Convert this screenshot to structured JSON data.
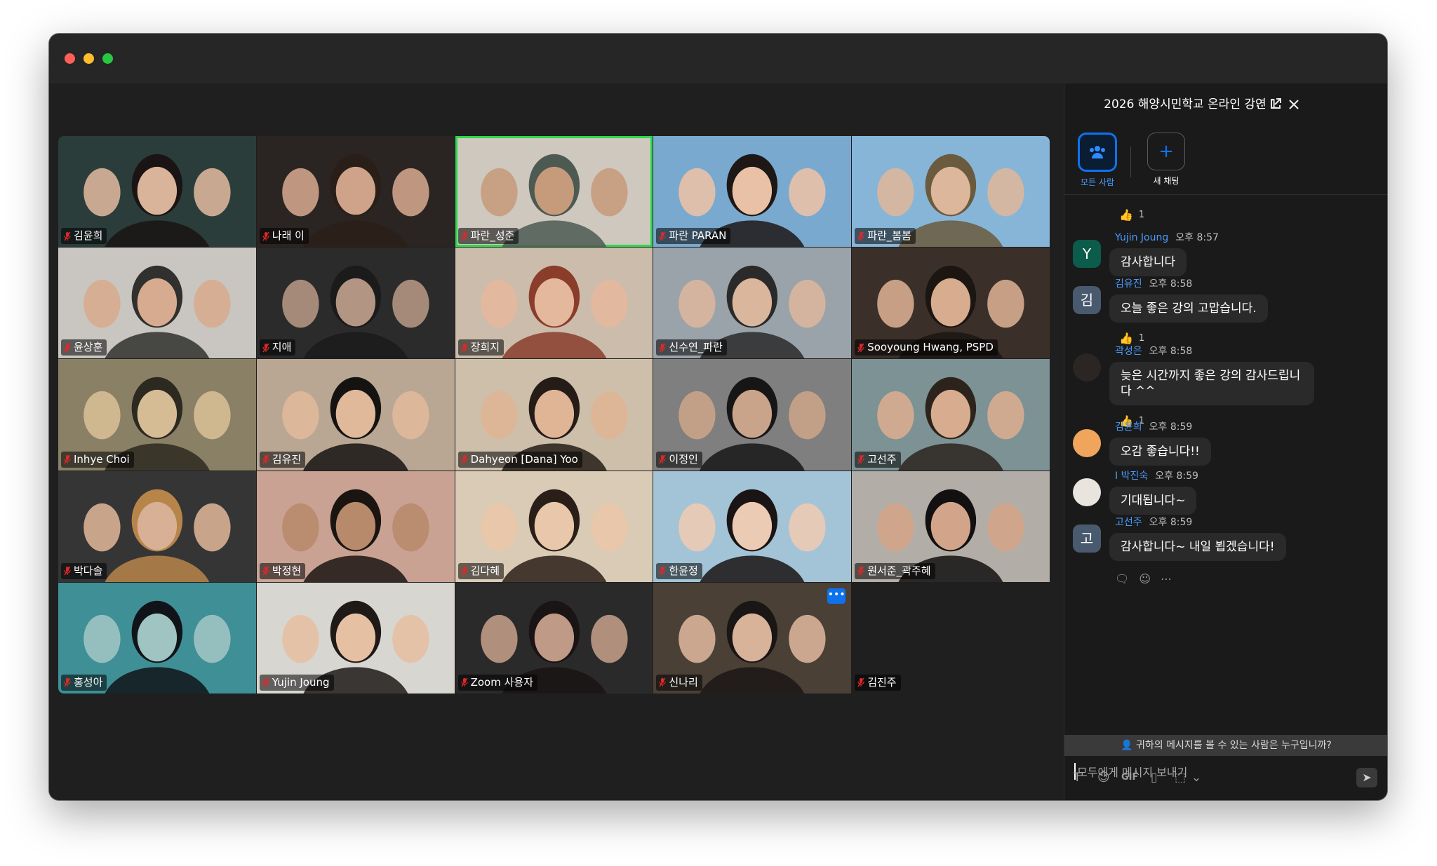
{
  "meeting": {
    "tiles": [
      {
        "name": "김윤희",
        "bg": "#2b3d3a",
        "skin": "#d9b49a",
        "hair": "#1a1414"
      },
      {
        "name": "나래 이",
        "bg": "#2a2522",
        "skin": "#cfa389",
        "hair": "#2a1e18"
      },
      {
        "name": "파란_성준",
        "bg": "#cfc8bf",
        "skin": "#c69b7c",
        "hair": "#4c5a52",
        "active": true
      },
      {
        "name": "파란 PARAN",
        "bg": "#79a9cf",
        "skin": "#e8c1a6",
        "hair": "#1d1716"
      },
      {
        "name": "파란_봄봄",
        "bg": "#86b5d8",
        "skin": "#dcb79c",
        "hair": "#6a5a3e"
      },
      {
        "name": "윤상훈",
        "bg": "#c9c5c1",
        "skin": "#d7ab8f",
        "hair": "#30302e"
      },
      {
        "name": "지애",
        "bg": "#2b2b2b",
        "skin": "#b39583",
        "hair": "#1b1b1b"
      },
      {
        "name": "장희지",
        "bg": "#cbbcab",
        "skin": "#e4b89c",
        "hair": "#8a3d2b"
      },
      {
        "name": "신수연_파란",
        "bg": "#9aa3aa",
        "skin": "#dab69d",
        "hair": "#2a2a2a"
      },
      {
        "name": "Sooyoung Hwang, PSPD",
        "bg": "#3a3029",
        "skin": "#d7ac8f",
        "hair": "#1c1613"
      },
      {
        "name": "Inhye Choi",
        "bg": "#8a8066",
        "skin": "#d6bc95",
        "hair": "#2c2920"
      },
      {
        "name": "김유진",
        "bg": "#b9a794",
        "skin": "#e0b99a",
        "hair": "#151312"
      },
      {
        "name": "Dahyeon [Dana] Yoo",
        "bg": "#cdbfaa",
        "skin": "#dfb596",
        "hair": "#251c17"
      },
      {
        "name": "이정인",
        "bg": "#7f7f7f",
        "skin": "#caa48a",
        "hair": "#161616"
      },
      {
        "name": "고선주",
        "bg": "#7d9294",
        "skin": "#d8ad8f",
        "hair": "#2c231d"
      },
      {
        "name": "박다솔",
        "bg": "#353535",
        "skin": "#d8b095",
        "hair": "#b7854a"
      },
      {
        "name": "박정현",
        "bg": "#c9a294",
        "skin": "#b88a6c",
        "hair": "#1b1512"
      },
      {
        "name": "김다혜",
        "bg": "#d9cbb5",
        "skin": "#e9c7aa",
        "hair": "#2a1f18"
      },
      {
        "name": "한윤정",
        "bg": "#a3c4d6",
        "skin": "#eccbb5",
        "hair": "#1a1414"
      },
      {
        "name": "원서준_곽주혜",
        "bg": "#b2aea7",
        "skin": "#d2a58a",
        "hair": "#121010"
      },
      {
        "name": "홍성아",
        "bg": "#3f8f96",
        "skin": "#9fc4c2",
        "hair": "#101418"
      },
      {
        "name": "Yujin Joung",
        "bg": "#d8d6d1",
        "skin": "#e6c0a3",
        "hair": "#1f1a17"
      },
      {
        "name": "Zoom 사용자",
        "bg": "#2a2a2a",
        "skin": "#bf9a86",
        "hair": "#1a1414"
      },
      {
        "name": "신나리",
        "bg": "#4b4036",
        "skin": "#d9b29a",
        "hair": "#1b1616",
        "more": "•••"
      },
      {
        "name": "김진주",
        "bg": "#1f1f1f",
        "skin": null,
        "hair": null
      }
    ]
  },
  "chat": {
    "title": "2026 해양시민학교 온라인 강연 1",
    "header_icons": [
      "more-icon",
      "pop-out-icon",
      "close-icon"
    ],
    "tabs": {
      "everyone": "모든 사람",
      "new_chat": "새 채팅"
    },
    "top_reaction": {
      "emoji": "👍",
      "count": "1"
    },
    "messages": [
      {
        "avatar": "Y",
        "avatar_color": "#0b5c4a",
        "sender": "Yujin Joung",
        "time": "오후 8:57",
        "text": "감사합니다"
      },
      {
        "avatar": "김",
        "avatar_color": "#4a5a6e",
        "sender": "김유진",
        "time": "오후 8:58",
        "text": "오늘 좋은 강의 고맙습니다.",
        "reaction": {
          "emoji": "👍",
          "count": "1"
        }
      },
      {
        "avatar": "",
        "avatar_color": "#2b2623",
        "sender": "곽성은",
        "time": "오후 8:58",
        "text": "늦은 시간까지 좋은 강의 감사드립니다 ^^",
        "reaction": {
          "emoji": "👍",
          "count": "1"
        }
      },
      {
        "avatar": "",
        "avatar_color": "#f1a55c",
        "sender": "김윤희",
        "time": "오후 8:59",
        "text": "오감 좋습니다!!"
      },
      {
        "avatar": "",
        "avatar_color": "#e9e4de",
        "sender": "I 박진숙",
        "time": "오후 8:59",
        "text": "기대됩니다~"
      },
      {
        "avatar": "고",
        "avatar_color": "#4a5a6e",
        "sender": "고선주",
        "time": "오후 8:59",
        "text": "감사합니다~ 내일 뵙겠습니다!"
      }
    ],
    "visibility_text": "귀하의 메시지를 볼 수 있는 사람은 누구입니까?",
    "input_placeholder": "모두에게 메시지 보내기",
    "toolbar": {
      "format": "T",
      "emoji": "☺",
      "gif": "GIF",
      "file": "▯",
      "screenshot": "⬚",
      "dropdown": "⌄",
      "send": "➤"
    }
  }
}
